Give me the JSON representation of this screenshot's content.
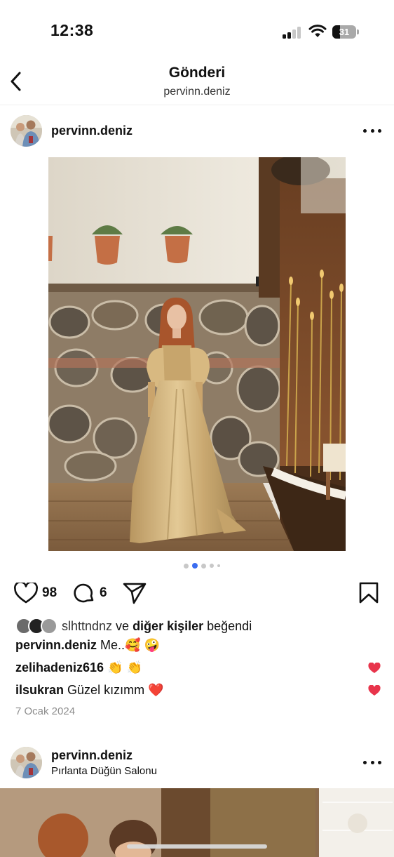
{
  "status_bar": {
    "time": "12:38",
    "battery": "31",
    "icons": [
      "signal-icon",
      "wifi-icon",
      "battery-icon"
    ]
  },
  "header": {
    "title": "Gönderi",
    "subtitle": "pervinn.deniz",
    "back_icon": "chevron-left-icon"
  },
  "post": {
    "username": "pervinn.deniz",
    "more_icon": "more-horizontal-icon",
    "carousel": {
      "count": 5,
      "active": 1
    },
    "actions": {
      "likes_count": "98",
      "comments_count": "6",
      "icons": [
        "heart-icon",
        "comment-icon",
        "share-icon",
        "bookmark-icon"
      ]
    },
    "liked_by": {
      "user": "slhttndnz",
      "connector": " ve ",
      "others": "diğer kişiler",
      "suffix": " beğendi"
    },
    "caption": {
      "username": "pervinn.deniz",
      "text": "Me..🥰 🤪"
    },
    "comments": [
      {
        "username": "zelihadeniz616",
        "text": "👏 👏"
      },
      {
        "username": "ilsukran",
        "text": "Güzel kızımm ❤️"
      }
    ],
    "date": "7 Ocak 2024"
  },
  "post2": {
    "username": "pervinn.deniz",
    "location": "Pırlanta Düğün Salonu"
  },
  "colors": {
    "text": "#111111",
    "muted": "#8e8e8e",
    "like_red": "#e8344b",
    "carousel_active": "#3a6cf0"
  }
}
